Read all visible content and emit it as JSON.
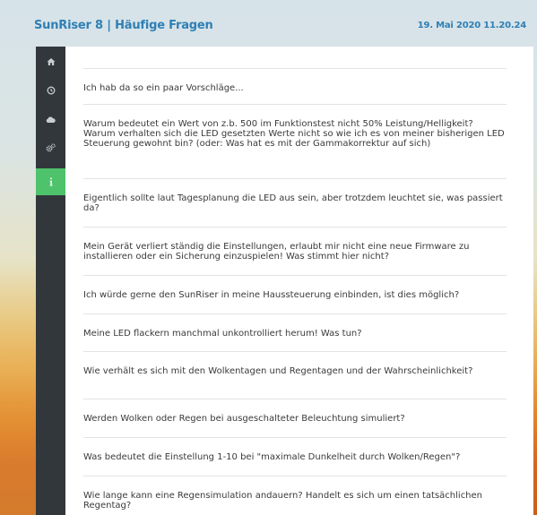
{
  "header": {
    "title": "SunRiser 8 | Häufige Fragen",
    "datetime": "19. Mai 2020 11.20.24"
  },
  "sidebar": {
    "items": [
      {
        "icon": "home-icon"
      },
      {
        "icon": "clock-icon"
      },
      {
        "icon": "cloud-icon"
      },
      {
        "icon": "gears-icon"
      },
      {
        "icon": "info-icon",
        "active": true
      }
    ]
  },
  "faq": {
    "questions": [
      "Ich hab da so ein paar Vorschläge...",
      "Warum bedeutet ein Wert von z.b. 500 im Funktionstest nicht 50% Leistung/Helligkeit? Warum verhalten sich die LED gesetzten Werte nicht so wie ich es von meiner bisherigen LED Steuerung gewohnt bin? (oder: Was hat es mit der Gammakorrektur auf sich)",
      "Eigentlich sollte laut Tagesplanung die LED aus sein, aber trotzdem leuchtet sie, was passiert da?",
      "Mein Gerät verliert ständig die Einstellungen, erlaubt mir nicht eine neue Firmware zu installieren oder ein Sicherung einzuspielen! Was stimmt hier nicht?",
      "Ich würde gerne den SunRiser in meine Haussteuerung einbinden, ist dies möglich?",
      "Meine LED flackern manchmal unkontrolliert herum! Was tun?",
      "Wie verhält es sich mit den Wolkentagen und Regentagen und der Wahrscheinlichkeit?",
      "Werden Wolken oder Regen bei ausgeschalteter Beleuchtung simuliert?",
      "Was bedeutet die Einstellung 1-10 bei \"maximale Dunkelheit durch Wolken/Regen\"?",
      "Wie lange kann eine Regensimulation andauern? Handelt es sich um einen tatsächlichen Regentag?"
    ]
  },
  "colors": {
    "accent": "#2f7fb5",
    "sidebar_bg": "#32373b",
    "active_nav": "#4ec36b"
  }
}
